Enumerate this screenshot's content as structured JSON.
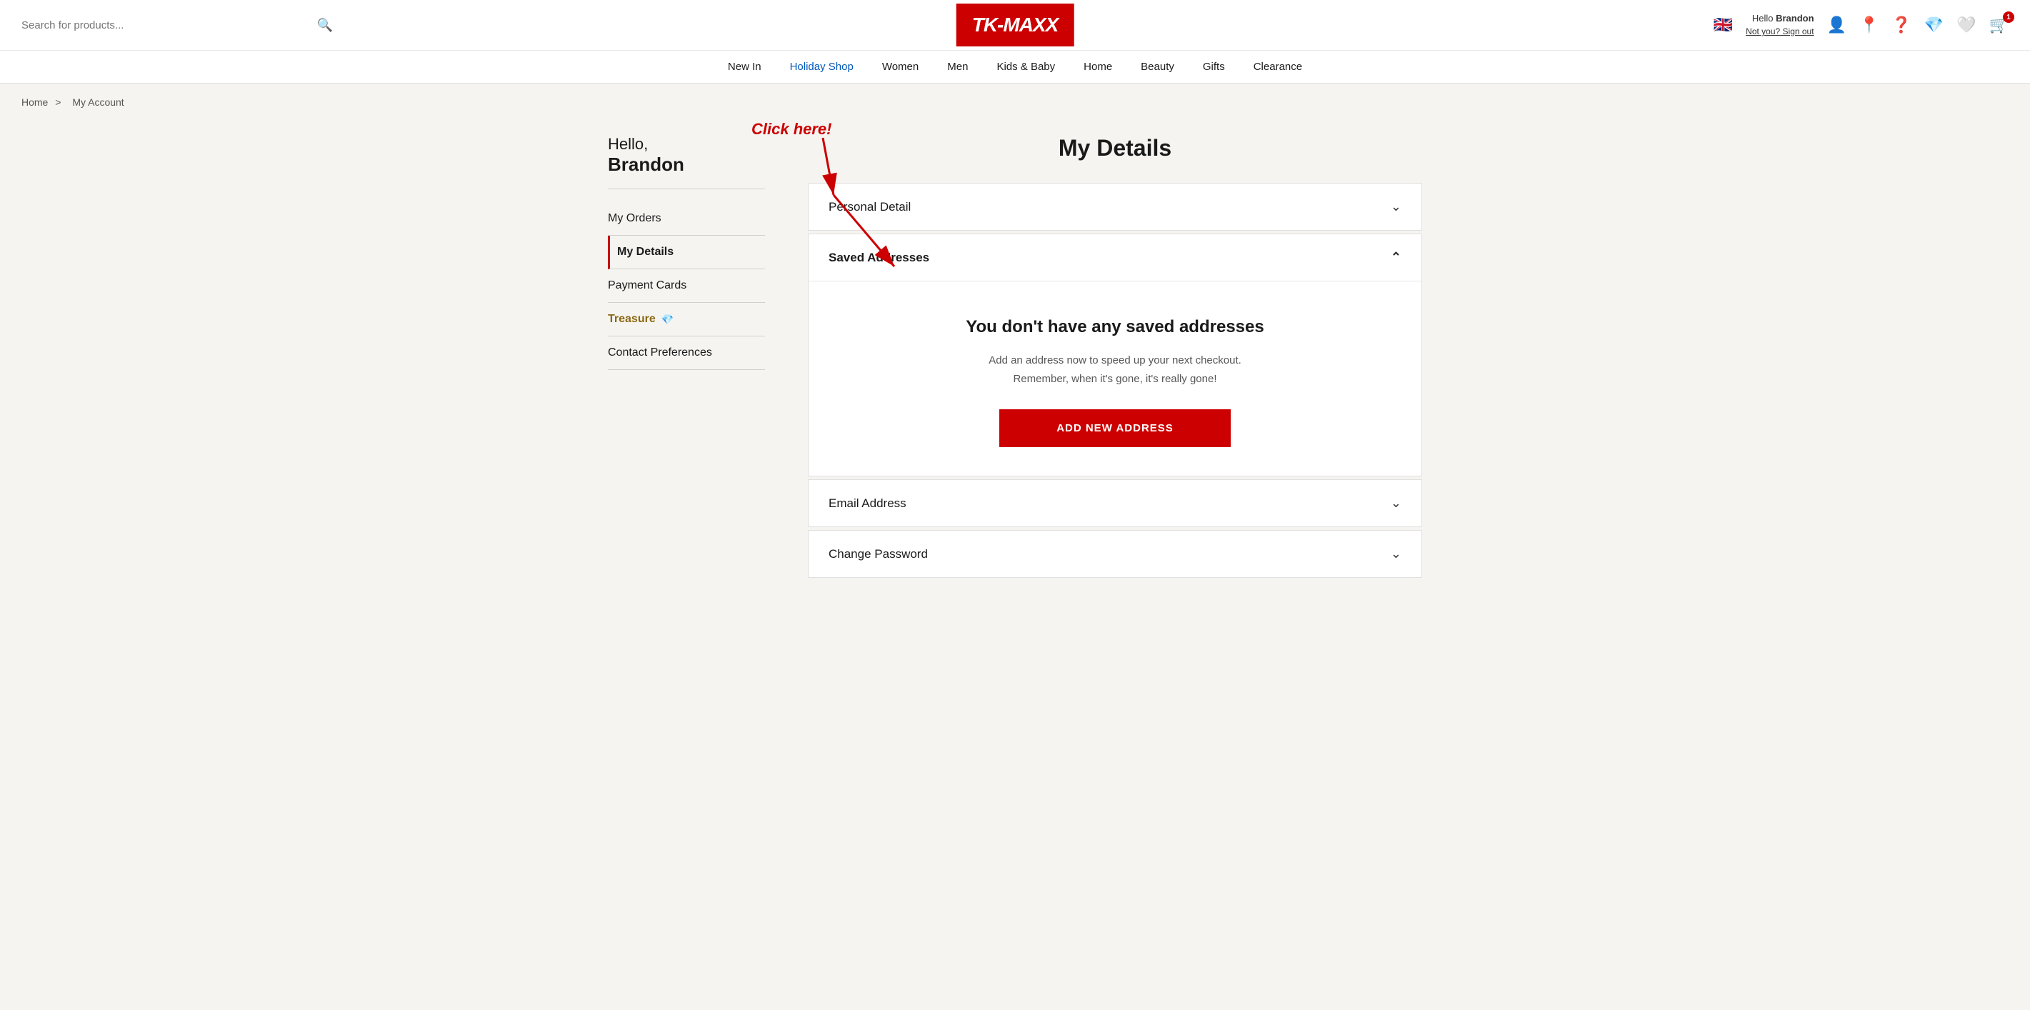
{
  "header": {
    "search_placeholder": "Search for products...",
    "logo_text": "TK-MAXX",
    "user_hello": "Hello",
    "user_name": "Brandon",
    "sign_out_text": "Not you? Sign out",
    "lang_flag": "🇬🇧",
    "cart_badge": "1"
  },
  "nav": {
    "items": [
      {
        "label": "New In",
        "active": false
      },
      {
        "label": "Holiday Shop",
        "active": true
      },
      {
        "label": "Women",
        "active": false
      },
      {
        "label": "Men",
        "active": false
      },
      {
        "label": "Kids & Baby",
        "active": false
      },
      {
        "label": "Home",
        "active": false
      },
      {
        "label": "Beauty",
        "active": false
      },
      {
        "label": "Gifts",
        "active": false
      },
      {
        "label": "Clearance",
        "active": false
      }
    ]
  },
  "breadcrumb": {
    "home": "Home",
    "separator": ">",
    "current": "My Account"
  },
  "sidebar": {
    "greeting": "Hello,",
    "user_name": "Brandon",
    "nav_items": [
      {
        "label": "My Orders",
        "active": false
      },
      {
        "label": "My Details",
        "active": true
      },
      {
        "label": "Payment Cards",
        "active": false
      },
      {
        "label": "Treasure",
        "active": false,
        "is_treasure": true
      },
      {
        "label": "Contact Preferences",
        "active": false
      }
    ]
  },
  "page": {
    "title": "My Details",
    "annotation_click_here": "Click here!",
    "sections": [
      {
        "id": "personal-detail",
        "label": "Personal Detail",
        "open": false
      },
      {
        "id": "saved-addresses",
        "label": "Saved Addresses",
        "open": true,
        "body": {
          "no_data_title": "You don't have any saved addresses",
          "no_data_desc_line1": "Add an address now to speed up your next checkout.",
          "no_data_desc_line2": "Remember, when it's gone, it's really gone!",
          "add_button_label": "ADD NEW ADDRESS"
        }
      },
      {
        "id": "email-address",
        "label": "Email Address",
        "open": false
      },
      {
        "id": "change-password",
        "label": "Change Password",
        "open": false
      }
    ]
  }
}
